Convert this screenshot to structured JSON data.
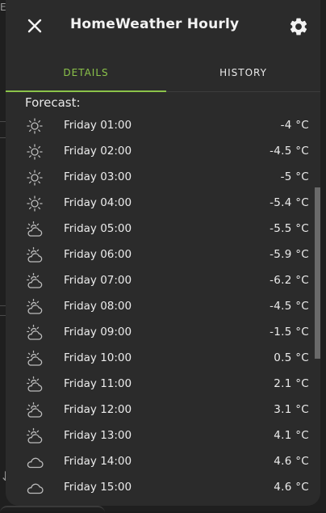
{
  "background": {
    "left_text": "EW",
    "arrow": "↓"
  },
  "dialog": {
    "title": "HomeWeather Hourly",
    "close_icon": "close-icon",
    "settings_icon": "gear-icon"
  },
  "tabs": [
    {
      "label": "DETAILS",
      "active": true
    },
    {
      "label": "HISTORY",
      "active": false
    }
  ],
  "forecast": {
    "label": "Forecast:",
    "rows": [
      {
        "time": "Friday 01:00",
        "temp": "-4 °C",
        "icon": "clear-night-icon"
      },
      {
        "time": "Friday 02:00",
        "temp": "-4.5 °C",
        "icon": "clear-night-icon"
      },
      {
        "time": "Friday 03:00",
        "temp": "-5 °C",
        "icon": "clear-night-icon"
      },
      {
        "time": "Friday 04:00",
        "temp": "-5.4 °C",
        "icon": "clear-night-icon"
      },
      {
        "time": "Friday 05:00",
        "temp": "-5.5 °C",
        "icon": "partly-cloudy-icon"
      },
      {
        "time": "Friday 06:00",
        "temp": "-5.9 °C",
        "icon": "partly-cloudy-icon"
      },
      {
        "time": "Friday 07:00",
        "temp": "-6.2 °C",
        "icon": "partly-cloudy-icon"
      },
      {
        "time": "Friday 08:00",
        "temp": "-4.5 °C",
        "icon": "partly-cloudy-icon"
      },
      {
        "time": "Friday 09:00",
        "temp": "-1.5 °C",
        "icon": "partly-cloudy-icon"
      },
      {
        "time": "Friday 10:00",
        "temp": "0.5 °C",
        "icon": "partly-cloudy-icon"
      },
      {
        "time": "Friday 11:00",
        "temp": "2.1 °C",
        "icon": "partly-cloudy-icon"
      },
      {
        "time": "Friday 12:00",
        "temp": "3.1 °C",
        "icon": "partly-cloudy-icon"
      },
      {
        "time": "Friday 13:00",
        "temp": "4.1 °C",
        "icon": "partly-cloudy-icon"
      },
      {
        "time": "Friday 14:00",
        "temp": "4.6 °C",
        "icon": "cloudy-icon"
      },
      {
        "time": "Friday 15:00",
        "temp": "4.6 °C",
        "icon": "cloudy-icon"
      }
    ]
  },
  "colors": {
    "accent": "#8bc34a",
    "dialog_bg": "#2b2b2b",
    "text": "#ececec"
  }
}
